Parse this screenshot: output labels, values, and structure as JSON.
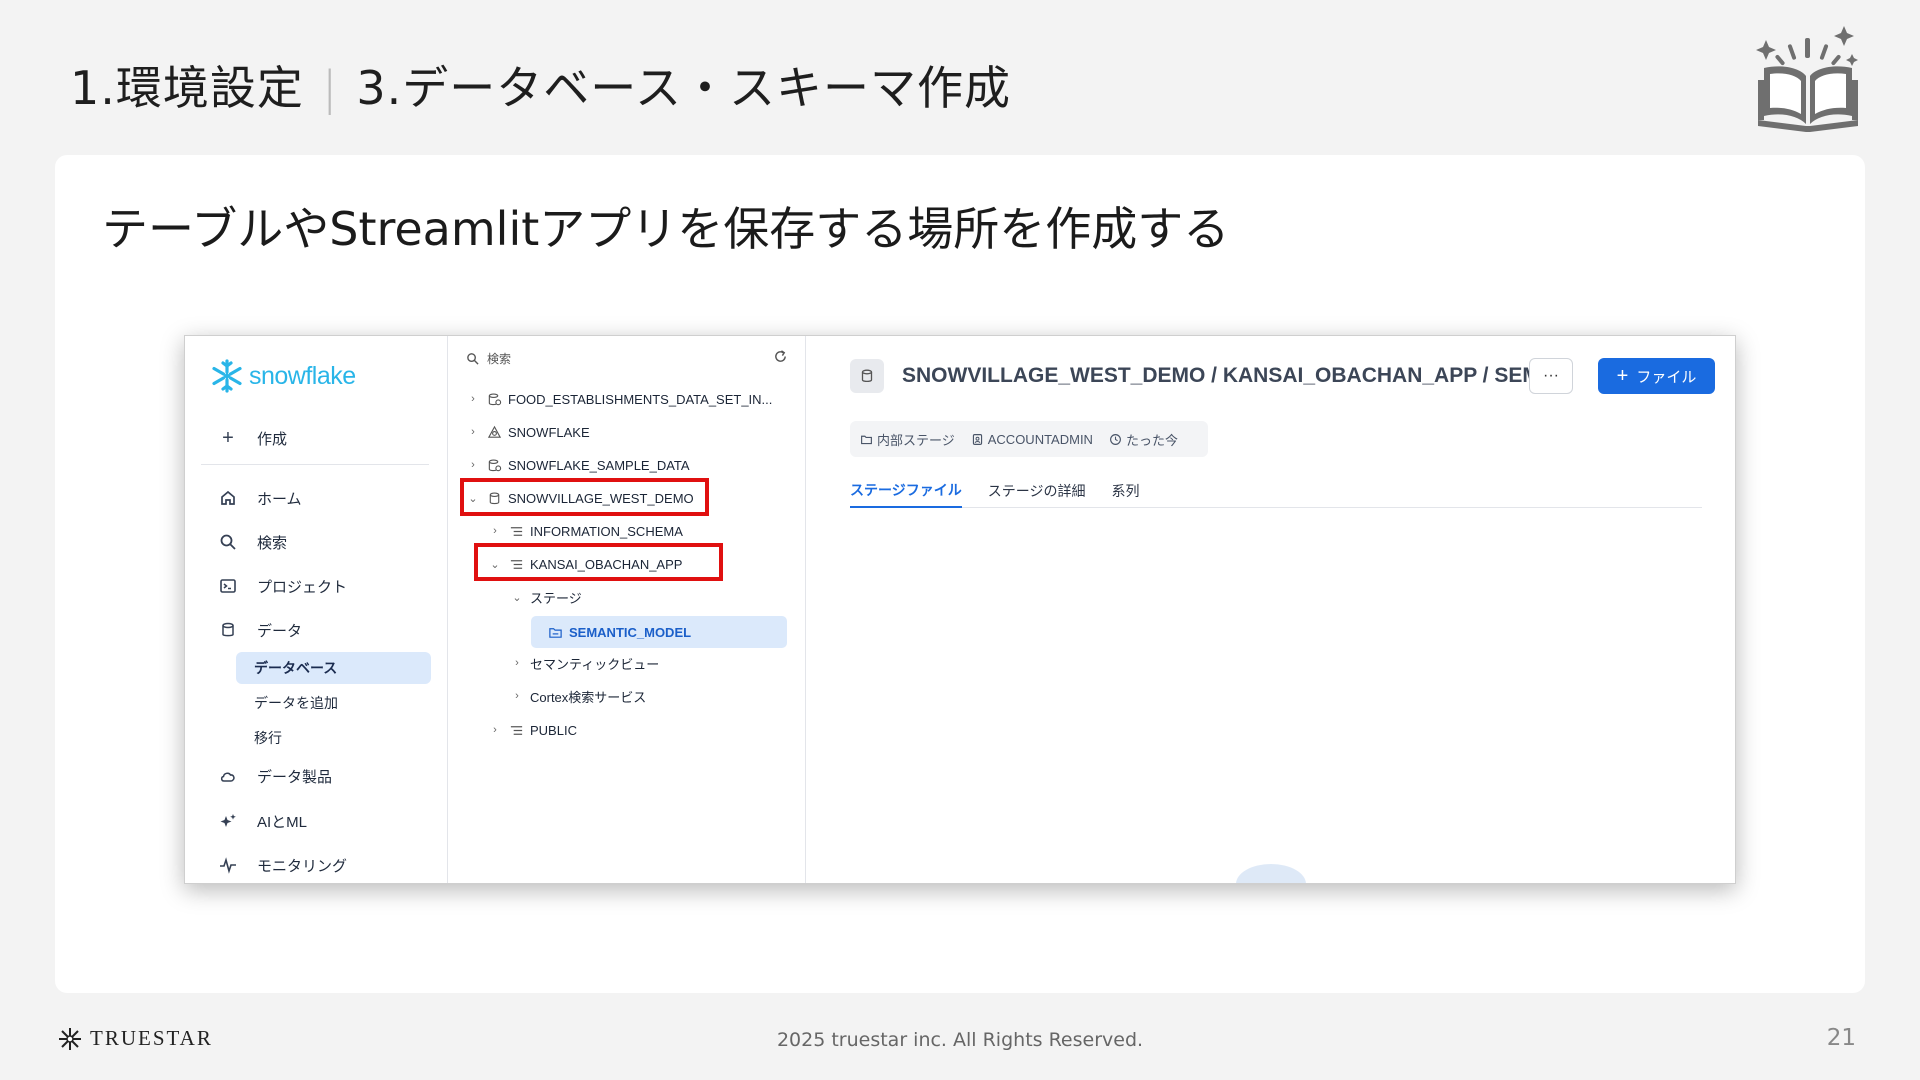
{
  "slide": {
    "title_section": "1.環境設定",
    "title_separator": "|",
    "title_topic": "3.データベース・スキーマ作成",
    "heading": "テーブルやStreamlitアプリを保存する場所を作成する",
    "footer_brand": "TRUESTAR",
    "copyright": "2025 truestar inc. All Rights Reserved.",
    "page_number": "21"
  },
  "app": {
    "logo_text": "snowflake",
    "sidebar": {
      "create": "作成",
      "items": [
        {
          "label": "ホーム",
          "icon": "home-icon"
        },
        {
          "label": "検索",
          "icon": "search-icon"
        },
        {
          "label": "プロジェクト",
          "icon": "terminal-icon"
        },
        {
          "label": "データ",
          "icon": "database-icon"
        }
      ],
      "data_sub": [
        "データベース",
        "データを追加",
        "移行"
      ],
      "items_after": [
        {
          "label": "データ製品",
          "icon": "cloud-icon"
        },
        {
          "label": "AIとML",
          "icon": "sparkle-icon"
        },
        {
          "label": "モニタリング",
          "icon": "activity-icon"
        }
      ]
    },
    "tree": {
      "search_placeholder": "検索",
      "nodes": [
        "FOOD_ESTABLISHMENTS_DATA_SET_IN...",
        "SNOWFLAKE",
        "SNOWFLAKE_SAMPLE_DATA",
        "SNOWVILLAGE_WEST_DEMO",
        "INFORMATION_SCHEMA",
        "KANSAI_OBACHAN_APP",
        "ステージ",
        "SEMANTIC_MODEL",
        "セマンティックビュー",
        "Cortex検索サービス",
        "PUBLIC"
      ]
    },
    "main": {
      "title": "SNOWVILLAGE_WEST_DEMO / KANSAI_OBACHAN_APP / SEMANTIC_MODEL",
      "more": "···",
      "file_button": "ファイル",
      "meta": {
        "stage_type": "内部ステージ",
        "role": "ACCOUNTADMIN",
        "time": "たった今"
      },
      "tabs": [
        "ステージファイル",
        "ステージの詳細",
        "系列"
      ]
    }
  },
  "colors": {
    "snowflake_blue": "#29b5e8",
    "highlight_red": "#e01010",
    "primary_button": "#1a6be0"
  }
}
